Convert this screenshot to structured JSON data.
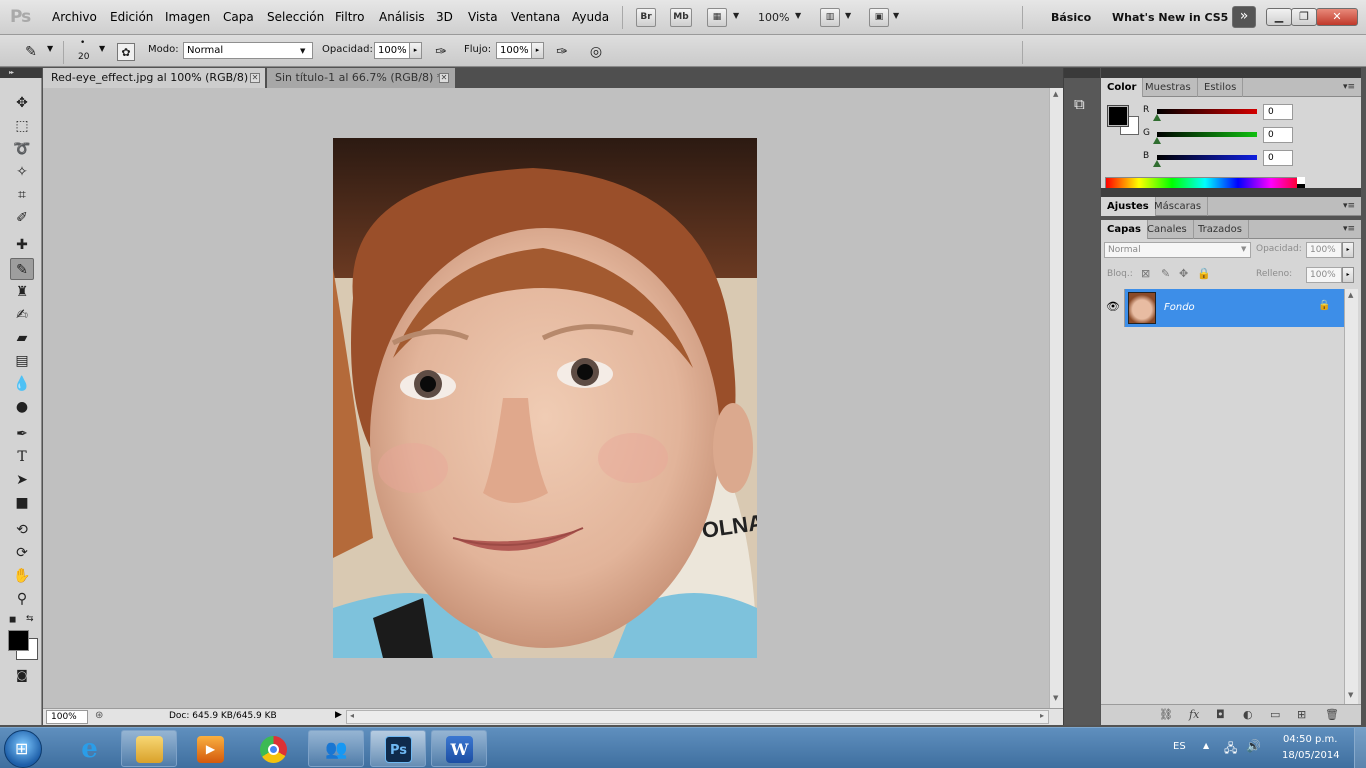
{
  "app": {
    "logo": "Ps"
  },
  "menu": [
    "Archivo",
    "Edición",
    "Imagen",
    "Capa",
    "Selección",
    "Filtro",
    "Análisis",
    "3D",
    "Vista",
    "Ventana",
    "Ayuda"
  ],
  "topbar": {
    "bridge": "Br",
    "minibridge": "Mb",
    "zoom": "100%",
    "workspace_basic": "Básico",
    "workspace_new": "What's New in CS5"
  },
  "options": {
    "brush_size": "20",
    "mode_label": "Modo:",
    "mode_value": "Normal",
    "opacity_label": "Opacidad:",
    "opacity_value": "100%",
    "flow_label": "Flujo:",
    "flow_value": "100%"
  },
  "tabs": [
    {
      "label": "Red-eye_effect.jpg al 100% (RGB/8) *",
      "active": true
    },
    {
      "label": "Sin título-1 al 66.7% (RGB/8) *",
      "active": false
    }
  ],
  "status": {
    "zoom": "100%",
    "doc": "Doc: 645.9 KB/645.9 KB"
  },
  "color_panel": {
    "tabs": [
      "Color",
      "Muestras",
      "Estilos"
    ],
    "channels": [
      {
        "label": "R",
        "value": "0",
        "color": "#d40000"
      },
      {
        "label": "G",
        "value": "0",
        "color": "#10c010"
      },
      {
        "label": "B",
        "value": "0",
        "color": "#1020e0"
      }
    ],
    "foreground": "#000000",
    "background": "#ffffff"
  },
  "adjust_panel": {
    "tabs": [
      "Ajustes",
      "Máscaras"
    ]
  },
  "layers_panel": {
    "tabs": [
      "Capas",
      "Canales",
      "Trazados"
    ],
    "blend_mode": "Normal",
    "opacity_label": "Opacidad:",
    "opacity_value": "100%",
    "lock_label": "Bloq.:",
    "fill_label": "Relleno:",
    "fill_value": "100%",
    "layers": [
      {
        "name": "Fondo",
        "selected": true,
        "locked": true
      }
    ]
  },
  "taskbar": {
    "language": "ES",
    "time": "04:50 p.m.",
    "date": "18/05/2014",
    "ps_label": "Ps",
    "word_label": "W"
  },
  "colors": {
    "selection": "#3d8ee8",
    "canvas": "#c0c0c0",
    "taskbar": "#4f7fb0"
  }
}
